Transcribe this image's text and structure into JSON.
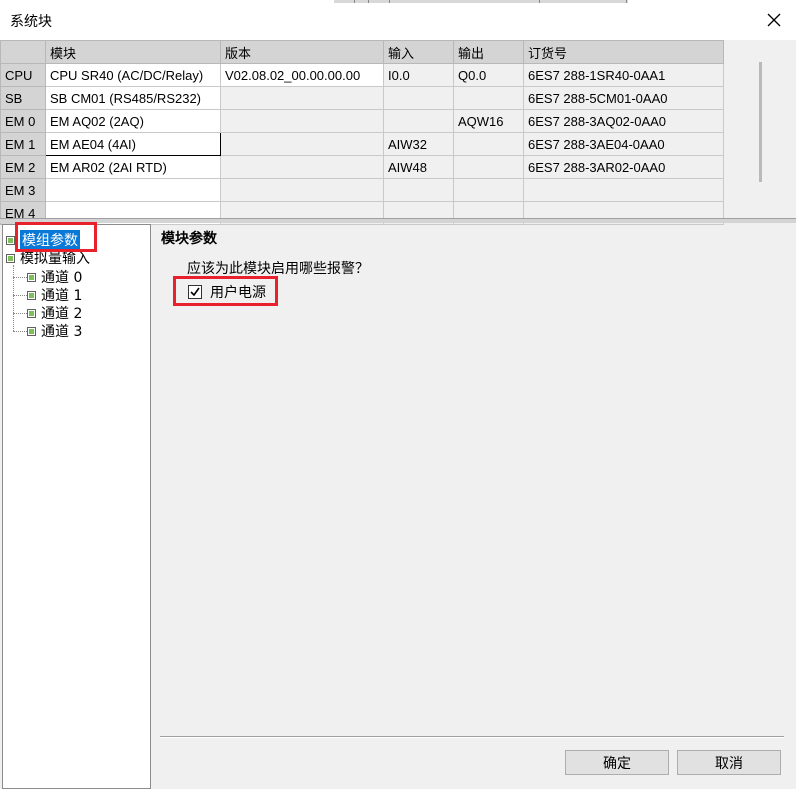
{
  "window": {
    "title": "系统块",
    "close_icon": "close-icon"
  },
  "grid": {
    "headers": [
      "",
      "模块",
      "版本",
      "输入",
      "输出",
      "订货号"
    ],
    "rows": [
      {
        "id": "CPU",
        "module": "CPU SR40 (AC/DC/Relay)",
        "version": "V02.08.02_00.00.00.00",
        "input": "I0.0",
        "output": "Q0.0",
        "order": "6ES7 288-1SR40-0AA1"
      },
      {
        "id": "SB",
        "module": "SB CM01 (RS485/RS232)",
        "version": "",
        "input": "",
        "output": "",
        "order": "6ES7 288-5CM01-0AA0"
      },
      {
        "id": "EM 0",
        "module": "EM AQ02 (2AQ)",
        "version": "",
        "input": "",
        "output": "AQW16",
        "order": "6ES7 288-3AQ02-0AA0"
      },
      {
        "id": "EM 1",
        "module": "EM AE04 (4AI)",
        "version": "",
        "input": "AIW32",
        "output": "",
        "order": "6ES7 288-3AE04-0AA0"
      },
      {
        "id": "EM 2",
        "module": "EM AR02 (2AI RTD)",
        "version": "",
        "input": "AIW48",
        "output": "",
        "order": "6ES7 288-3AR02-0AA0"
      },
      {
        "id": "EM 3",
        "module": "",
        "version": "",
        "input": "",
        "output": "",
        "order": ""
      },
      {
        "id": "EM 4",
        "module": "",
        "version": "",
        "input": "",
        "output": "",
        "order": ""
      }
    ]
  },
  "tree": {
    "items": [
      {
        "label": "模组参数",
        "selected": true
      },
      {
        "label": "模拟量输入"
      },
      {
        "label": "通道 0"
      },
      {
        "label": "通道 1"
      },
      {
        "label": "通道 2"
      },
      {
        "label": "通道 3"
      }
    ]
  },
  "panel": {
    "section_title": "模块参数",
    "question": "应该为此模块启用哪些报警？",
    "checkbox_label": "用户电源",
    "checkbox_checked": true
  },
  "buttons": {
    "ok": "确定",
    "cancel": "取消"
  },
  "colors": {
    "highlight": "#e8212d",
    "selection": "#0a78d7",
    "tree_node": "#7ac15a"
  }
}
